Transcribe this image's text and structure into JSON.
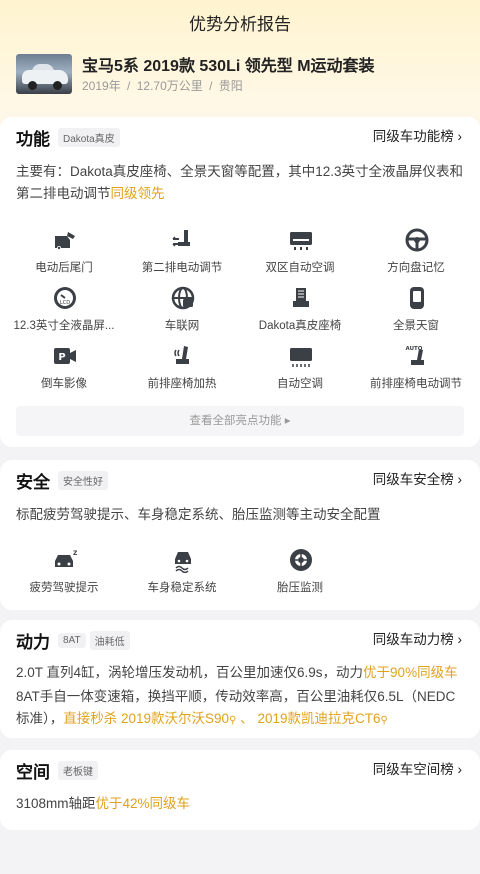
{
  "page": {
    "title": "优势分析报告"
  },
  "car": {
    "name": "宝马5系 2019款 530Li 领先型 M运动套装",
    "year": "2019年",
    "mileage": "12.70万公里",
    "city": "贵阳",
    "separator": "/"
  },
  "features": {
    "title": "功能",
    "tag": "Dakota真皮",
    "rank_link": "同级车功能榜 ›",
    "desc_main": "主要有：Dakota真皮座椅、全景天窗等配置，其中12.3英寸全液晶屏仪表和第二排电动调节",
    "desc_highlight": "同级领先",
    "items": [
      {
        "label": "电动后尾门",
        "icon": "tailgate-icon"
      },
      {
        "label": "第二排电动调节",
        "icon": "seat-adjust-icon"
      },
      {
        "label": "双区自动空调",
        "icon": "ac-icon"
      },
      {
        "label": "方向盘记忆",
        "icon": "steering-wheel-icon"
      },
      {
        "label": "12.3英寸全液晶屏...",
        "icon": "lcd-gauge-icon"
      },
      {
        "label": "车联网",
        "icon": "globe-icon"
      },
      {
        "label": "Dakota真皮座椅",
        "icon": "leather-seat-icon"
      },
      {
        "label": "全景天窗",
        "icon": "sunroof-icon"
      },
      {
        "label": "倒车影像",
        "icon": "parking-camera-icon"
      },
      {
        "label": "前排座椅加热",
        "icon": "seat-heat-icon"
      },
      {
        "label": "自动空调",
        "icon": "auto-ac-icon"
      },
      {
        "label": "前排座椅电动调节",
        "icon": "auto-seat-icon"
      }
    ],
    "more_label": "查看全部亮点功能 ▸"
  },
  "safety": {
    "title": "安全",
    "tag": "安全性好",
    "rank_link": "同级车安全榜 ›",
    "desc": "标配疲劳驾驶提示、车身稳定系统、胎压监测等主动安全配置",
    "items": [
      {
        "label": "疲劳驾驶提示",
        "icon": "drowsy-car-icon"
      },
      {
        "label": "车身稳定系统",
        "icon": "esp-icon"
      },
      {
        "label": "胎压监测",
        "icon": "tire-pressure-icon"
      }
    ]
  },
  "power": {
    "title": "动力",
    "tags": [
      "8AT",
      "油耗低"
    ],
    "rank_link": "同级车动力榜 ›",
    "desc1_main": "2.0T 直列4缸，涡轮增压发动机，百公里加速仅6.9s，动力",
    "desc1_highlight": "优于90%同级车",
    "desc2_main": "8AT手自一体变速箱，换挡平顺，传动效率高，百公里油耗仅6.5L（NEDC标准），",
    "desc2_highlight_prefix": "直接秒杀",
    "desc2_link1": "2019款沃尔沃S90",
    "desc2_sep": "、",
    "desc2_link2": "2019款凯迪拉克CT6"
  },
  "space": {
    "title": "空间",
    "tag": "老板键",
    "rank_link": "同级车空间榜 ›",
    "desc_main": "3108mm轴距",
    "desc_highlight": "优于42%同级车"
  },
  "colors": {
    "accent": "#e0a21b",
    "bg": "#f3f3f5",
    "header": "#fff3cf"
  }
}
